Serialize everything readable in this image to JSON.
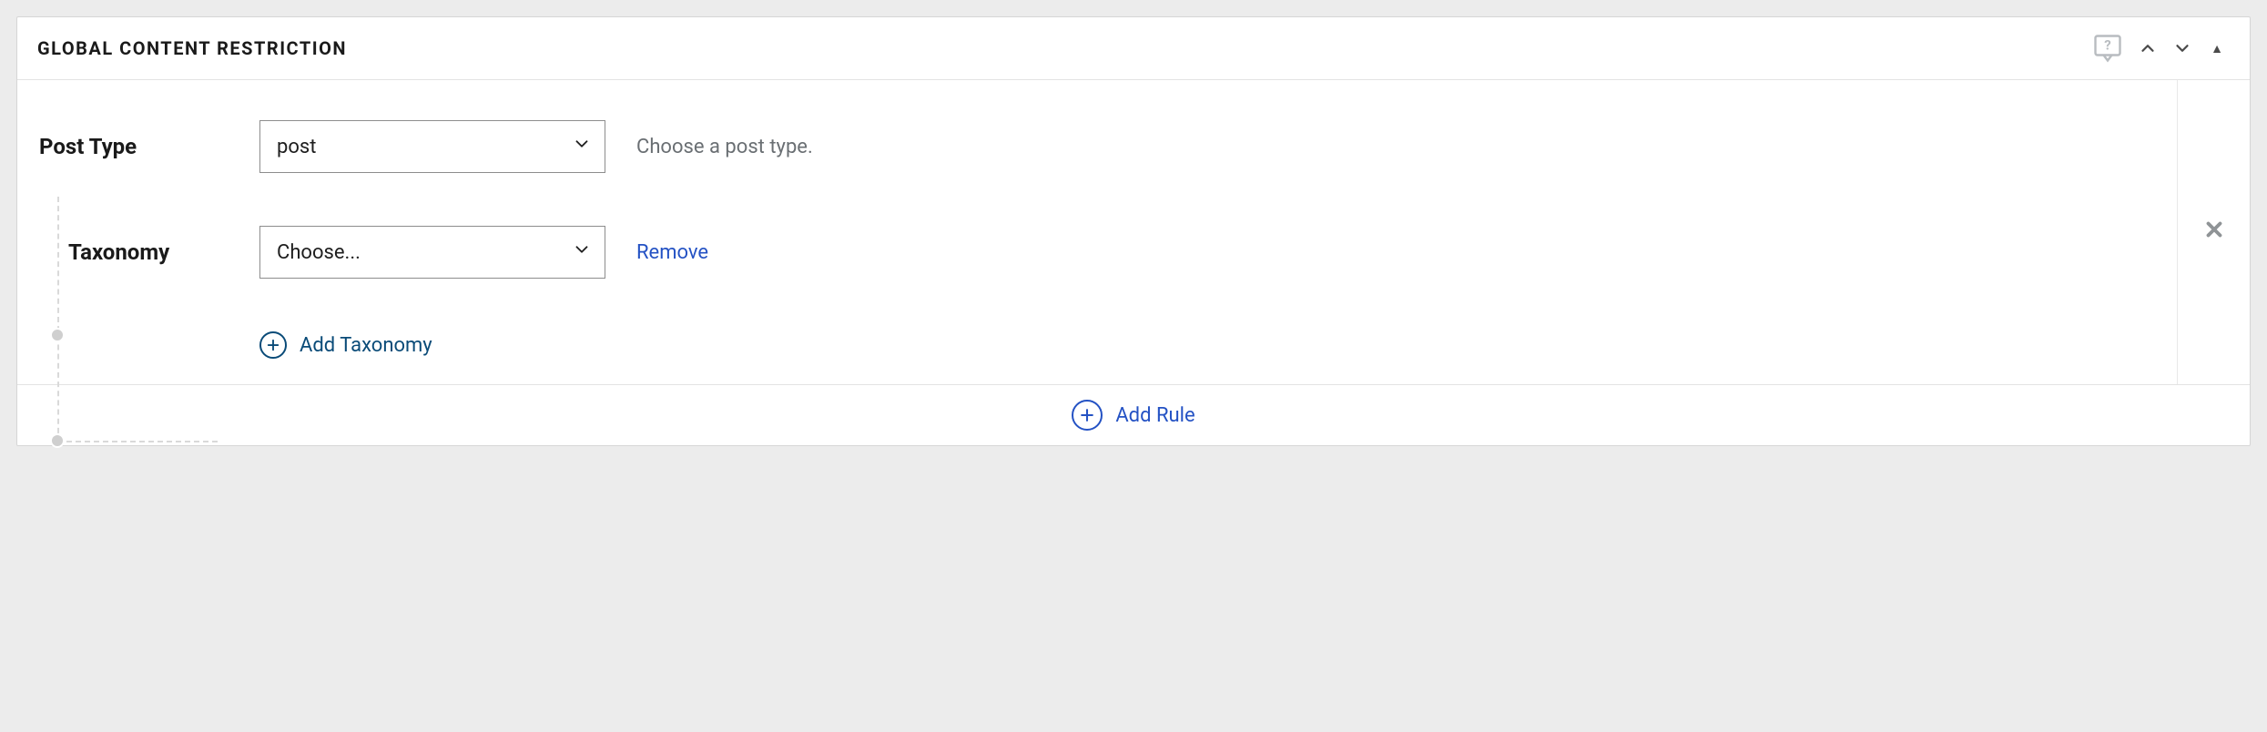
{
  "panel": {
    "title": "GLOBAL CONTENT RESTRICTION"
  },
  "fields": {
    "post_type": {
      "label": "Post Type",
      "value": "post",
      "hint": "Choose a post type."
    },
    "taxonomy": {
      "label": "Taxonomy",
      "value": "Choose...",
      "remove_label": "Remove"
    }
  },
  "actions": {
    "add_taxonomy": "Add Taxonomy",
    "add_rule": "Add Rule"
  }
}
